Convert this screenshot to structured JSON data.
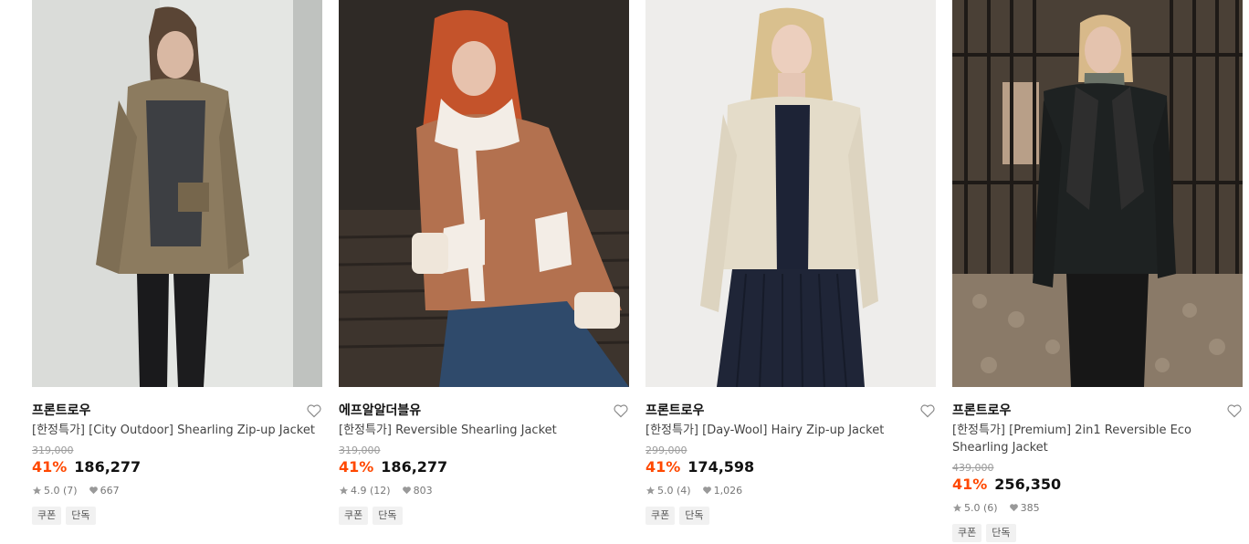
{
  "products": [
    {
      "brand": "프론트로우",
      "title": "[한정특가] [City Outdoor] Shearling Zip-up Jacket",
      "original_price": "319,000",
      "discount": "41%",
      "price": "186,277",
      "rating": "5.0",
      "reviews": "(7)",
      "likes": "667",
      "badges": [
        "쿠폰",
        "단독"
      ]
    },
    {
      "brand": "에프알알더블유",
      "title": "[한정특가] Reversible Shearling Jacket",
      "original_price": "319,000",
      "discount": "41%",
      "price": "186,277",
      "rating": "4.9",
      "reviews": "(12)",
      "likes": "803",
      "badges": [
        "쿠폰",
        "단독"
      ]
    },
    {
      "brand": "프론트로우",
      "title": "[한정특가] [Day-Wool] Hairy Zip-up Jacket",
      "original_price": "299,000",
      "discount": "41%",
      "price": "174,598",
      "rating": "5.0",
      "reviews": "(4)",
      "likes": "1,026",
      "badges": [
        "쿠폰",
        "단독"
      ]
    },
    {
      "brand": "프론트로우",
      "title": "[한정특가] [Premium] 2in1 Reversible Eco Shearling Jacket",
      "original_price": "439,000",
      "discount": "41%",
      "price": "256,350",
      "rating": "5.0",
      "reviews": "(6)",
      "likes": "385",
      "badges": [
        "쿠폰",
        "단독"
      ]
    }
  ],
  "colors": {
    "discount": "#ff4800",
    "badge_bg": "#f1f1f1",
    "meta_text": "#777777"
  },
  "icons": {
    "wishlist": "heart-outline-icon",
    "rating": "star-icon",
    "likes": "heart-filled-icon"
  }
}
